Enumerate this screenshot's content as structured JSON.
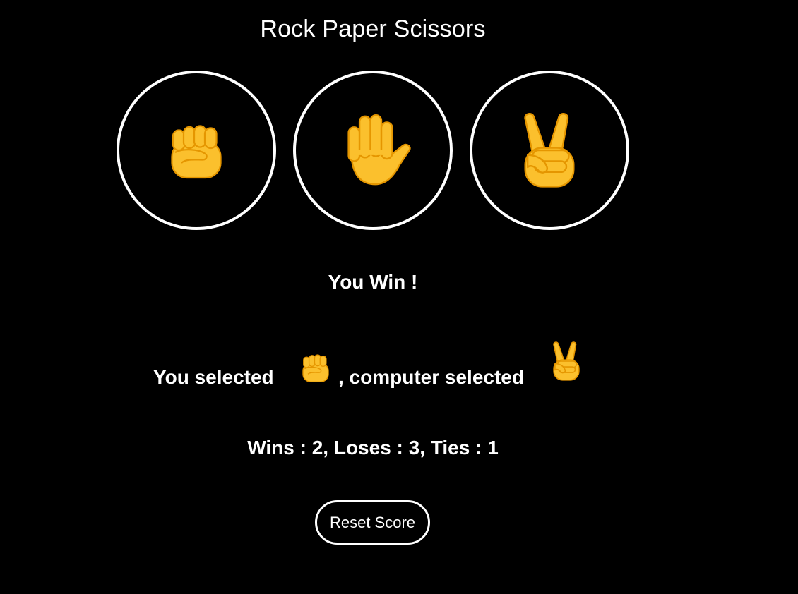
{
  "title": "Rock Paper Scissors",
  "choices": [
    {
      "id": "rock",
      "icon": "raised-fist-icon"
    },
    {
      "id": "paper",
      "icon": "raised-hand-icon"
    },
    {
      "id": "scissors",
      "icon": "victory-hand-icon"
    }
  ],
  "result": "You Win !",
  "selection": {
    "user_label": "You selected",
    "computer_label": ", computer selected",
    "user_choice_icon": "raised-fist-icon",
    "computer_choice_icon": "victory-hand-icon"
  },
  "score_text": "Wins : 2, Loses : 3, Ties : 1",
  "reset_label": "Reset Score",
  "colors": {
    "background": "#000000",
    "foreground": "#ffffff",
    "emoji_fill": "#FBC02D",
    "emoji_line": "#E59600"
  }
}
